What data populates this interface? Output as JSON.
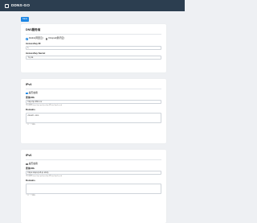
{
  "app": {
    "title": "DDNS-GO"
  },
  "toolbar": {
    "save_label": "Save"
  },
  "dns": {
    "title": "DNS服务商",
    "providers": [
      {
        "label": "Alidns(阿里云)",
        "selected": true
      },
      {
        "label": "Dnspod(腾讯云)",
        "selected": false
      }
    ],
    "accesskey_id_label": "AccessKey ID",
    "accesskey_id_value": "L",
    "accesskey_secret_label": "AccessKey Secret",
    "accesskey_secret_value": "Yq                                         nE"
  },
  "ipv4": {
    "title": "IPv4",
    "enabled_label": "是否启用",
    "url_label": "查询URL",
    "url_value": "http://ip.360.cn/",
    "help_text": "可以使用 https://api-ipv4.ip.sb/ip 或 http://ipv4.ip.sb",
    "domains_label": "Domains",
    "domains_value": "cloud.l       .com",
    "domains_help": "一行一个域名"
  },
  "ipv6": {
    "title": "IPv6",
    "enabled_label": "是否启用",
    "url_label": "查询URL",
    "url_value": "https://api-ipv6.ip.sb/ip",
    "help_text": "可以使用 https://api-ipv6.ip.sb/ip 或 http://ipv6.ip.sb",
    "domains_label": "Domains",
    "domains_value": "",
    "domains_help": "一行一个域名"
  }
}
